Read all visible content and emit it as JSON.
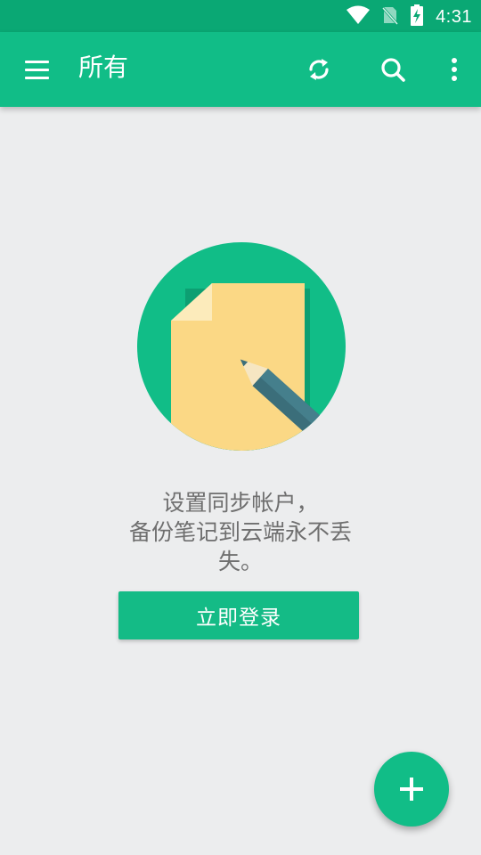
{
  "status_bar": {
    "time": "4:31",
    "icons": [
      "wifi-icon",
      "no-sim-icon",
      "battery-charging-icon"
    ]
  },
  "app_bar": {
    "title": "所有",
    "actions": [
      "menu-icon",
      "sync-icon",
      "search-icon",
      "more-vert-icon"
    ]
  },
  "empty_state": {
    "illustration": "note-with-pencil-icon",
    "message_lines": [
      "设置同步帐户，",
      "备份笔记到云端永不丢",
      "失。"
    ],
    "login_button_label": "立即登录"
  },
  "fab": {
    "icon": "plus-icon"
  },
  "colors": {
    "status_bar": "#0aa874",
    "primary": "#11bd87",
    "background": "#ecedee",
    "text_secondary": "#6f6f6f",
    "paper": "#fbd885",
    "pencil": "#3b6e7a"
  }
}
